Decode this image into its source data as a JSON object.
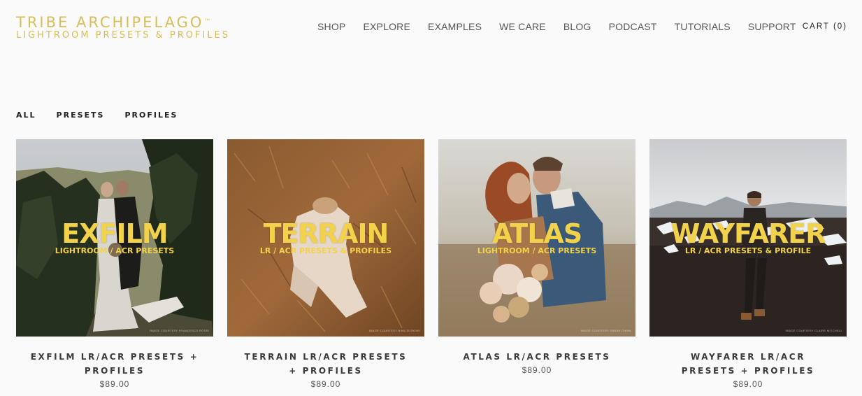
{
  "header": {
    "logo_title": "TRIBE ARCHIPELAGO",
    "logo_tm": "™",
    "logo_sub": "LIGHTROOM PRESETS & PROFILES",
    "nav": [
      "SHOP",
      "EXPLORE",
      "EXAMPLES",
      "WE CARE",
      "BLOG",
      "PODCAST",
      "TUTORIALS",
      "SUPPORT"
    ],
    "cart": "CART (0)"
  },
  "filters": [
    "ALL",
    "PRESETS",
    "PROFILES"
  ],
  "products": [
    {
      "overlay_title": "EXFILM",
      "overlay_sub": "LIGHTROOM / ACR PRESETS",
      "credit": "IMAGE COURTESY FRANCESCO ROSSI",
      "name": "EXFILM LR/ACR PRESETS + PROFILES",
      "price": "$89.00"
    },
    {
      "overlay_title": "TERRAIN",
      "overlay_sub": "LR / ACR PRESETS & PROFILES",
      "credit": "IMAGE COURTESY NINA SUSKINS",
      "name": "TERRAIN LR/ACR PRESETS + PROFILES",
      "price": "$89.00"
    },
    {
      "overlay_title": "ATLAS",
      "overlay_sub": "LIGHTROOM / ACR PRESETS",
      "credit": "IMAGE COURTESY SARAH CHINA",
      "name": "ATLAS LR/ACR PRESETS",
      "price": "$89.00"
    },
    {
      "overlay_title": "WAYFARER",
      "overlay_sub": "LR / ACR PRESETS & PROFILE",
      "credit": "IMAGE COURTESY CLAIRE MITCHELL",
      "name": "WAYFARER LR/ACR PRESETS + PROFILES",
      "price": "$89.00"
    }
  ],
  "colors": {
    "logo": "#d8bd5a",
    "overlay_text": "#f2d24b",
    "background": "#fafafa"
  }
}
